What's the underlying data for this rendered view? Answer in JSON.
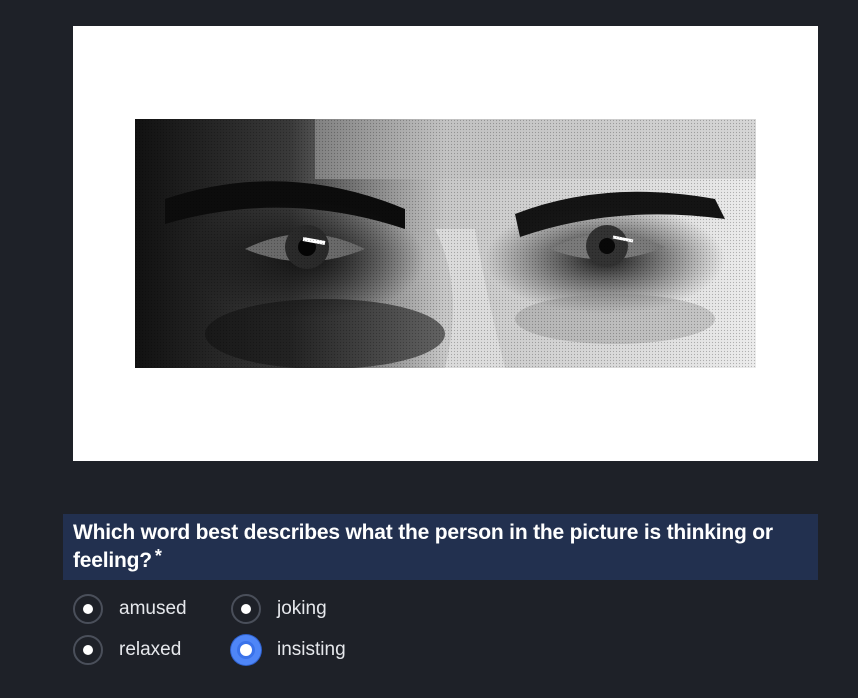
{
  "image": {
    "icon": "photo-of-eyes-icon",
    "description_alt": ""
  },
  "question": {
    "text": "Which word best describes what the person in the picture is thinking or feeling?",
    "required_marker": "*"
  },
  "options": [
    {
      "label": "amused",
      "selected": false
    },
    {
      "label": "joking",
      "selected": false
    },
    {
      "label": "relaxed",
      "selected": false
    },
    {
      "label": "insisting",
      "selected": true
    }
  ],
  "colors": {
    "background": "#1e2128",
    "question_bar": "#22304f",
    "accent": "#4f86f7"
  }
}
